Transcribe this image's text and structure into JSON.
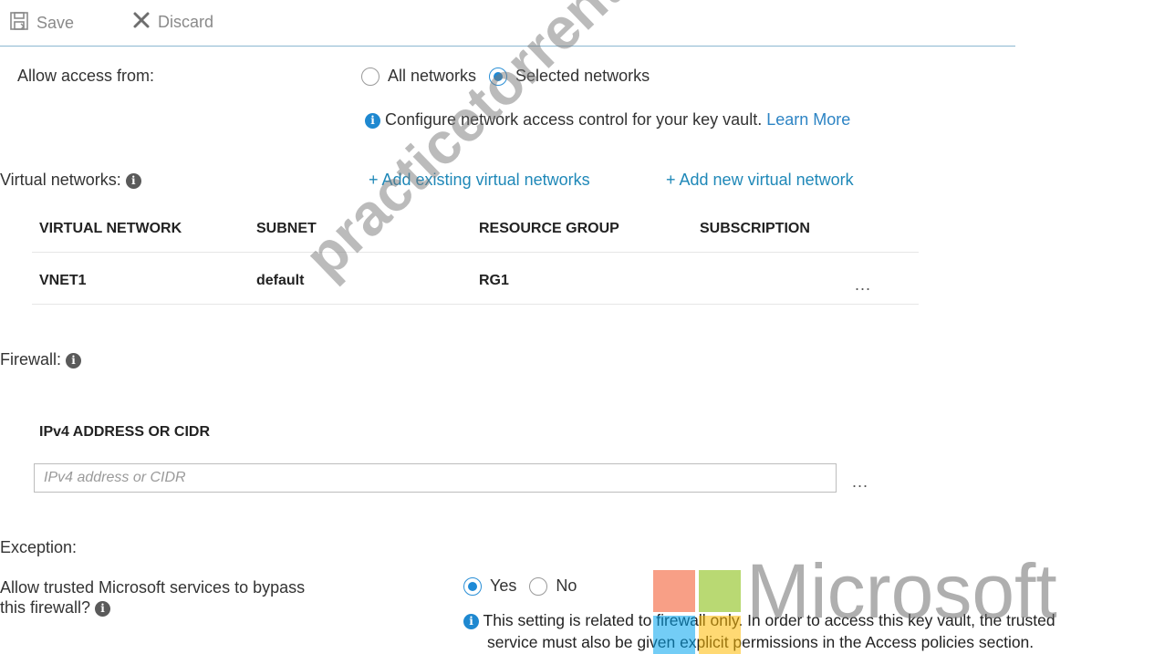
{
  "toolbar": {
    "save_label": "Save",
    "discard_label": "Discard"
  },
  "access": {
    "label": "Allow access from:",
    "options": [
      "All networks",
      "Selected networks"
    ],
    "selected": "Selected networks",
    "info_text": "Configure network access control for your key vault.",
    "learn_more": "Learn More"
  },
  "virtual_networks": {
    "label": "Virtual networks:",
    "add_existing": "+ Add existing virtual networks",
    "add_new": "+ Add new virtual network",
    "columns": [
      "VIRTUAL NETWORK",
      "SUBNET",
      "RESOURCE GROUP",
      "SUBSCRIPTION"
    ],
    "rows": [
      {
        "virtual_network": "VNET1",
        "subnet": "default",
        "resource_group": "RG1",
        "subscription": ""
      }
    ],
    "row_menu": "..."
  },
  "firewall": {
    "label": "Firewall:",
    "column_header": "IPv4 ADDRESS OR CIDR",
    "input_value": "",
    "input_placeholder": "IPv4 address or CIDR",
    "row_menu": "..."
  },
  "exception": {
    "heading": "Exception:",
    "question_line1": "Allow trusted Microsoft services to bypass",
    "question_line2": "this firewall?",
    "options": [
      "Yes",
      "No"
    ],
    "selected": "Yes",
    "note_line1": "This setting is related to firewall only. In order to access this key vault, the trusted",
    "note_line2": "service must also be given explicit permissions in the Access policies section."
  },
  "watermark": "practicetorrent.com",
  "logo": {
    "wordmark": "Microsoft",
    "colors": [
      "#f25022",
      "#7fba00",
      "#00a4ef",
      "#ffb900"
    ]
  },
  "colors": {
    "accent": "#1e8ad6",
    "link": "#2d84c4",
    "divider": "#8cb8d2"
  }
}
